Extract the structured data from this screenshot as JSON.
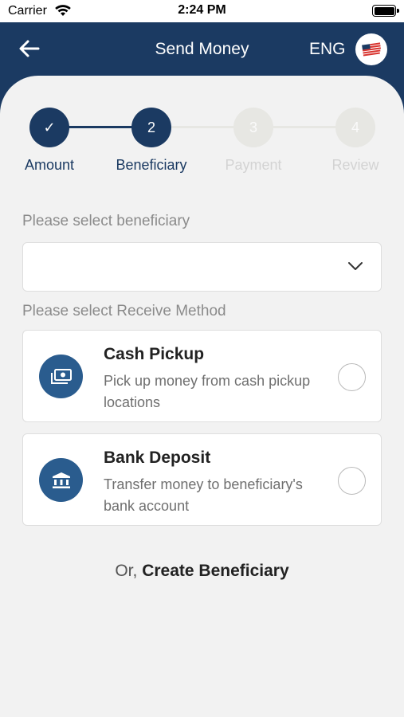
{
  "status_bar": {
    "carrier": "Carrier",
    "time": "2:24 PM"
  },
  "header": {
    "title": "Send Money",
    "language": "ENG"
  },
  "stepper": {
    "steps": [
      {
        "number": "✓",
        "label": "Amount",
        "state": "completed"
      },
      {
        "number": "2",
        "label": "Beneficiary",
        "state": "current"
      },
      {
        "number": "3",
        "label": "Payment",
        "state": "upcoming"
      },
      {
        "number": "4",
        "label": "Review",
        "state": "upcoming"
      }
    ]
  },
  "beneficiary": {
    "label": "Please select beneficiary",
    "value": ""
  },
  "receive_method": {
    "label": "Please select Receive Method",
    "options": [
      {
        "title": "Cash Pickup",
        "description": "Pick up money from cash pickup locations",
        "icon": "cash-icon",
        "selected": false
      },
      {
        "title": "Bank Deposit",
        "description": "Transfer money to beneficiary's bank account",
        "icon": "bank-icon",
        "selected": false
      }
    ]
  },
  "create_beneficiary": {
    "prefix": "Or,",
    "link": "Create Beneficiary"
  },
  "colors": {
    "primary": "#1b3a62",
    "icon_bg": "#2a5c8e",
    "background": "#f2f2f2"
  }
}
